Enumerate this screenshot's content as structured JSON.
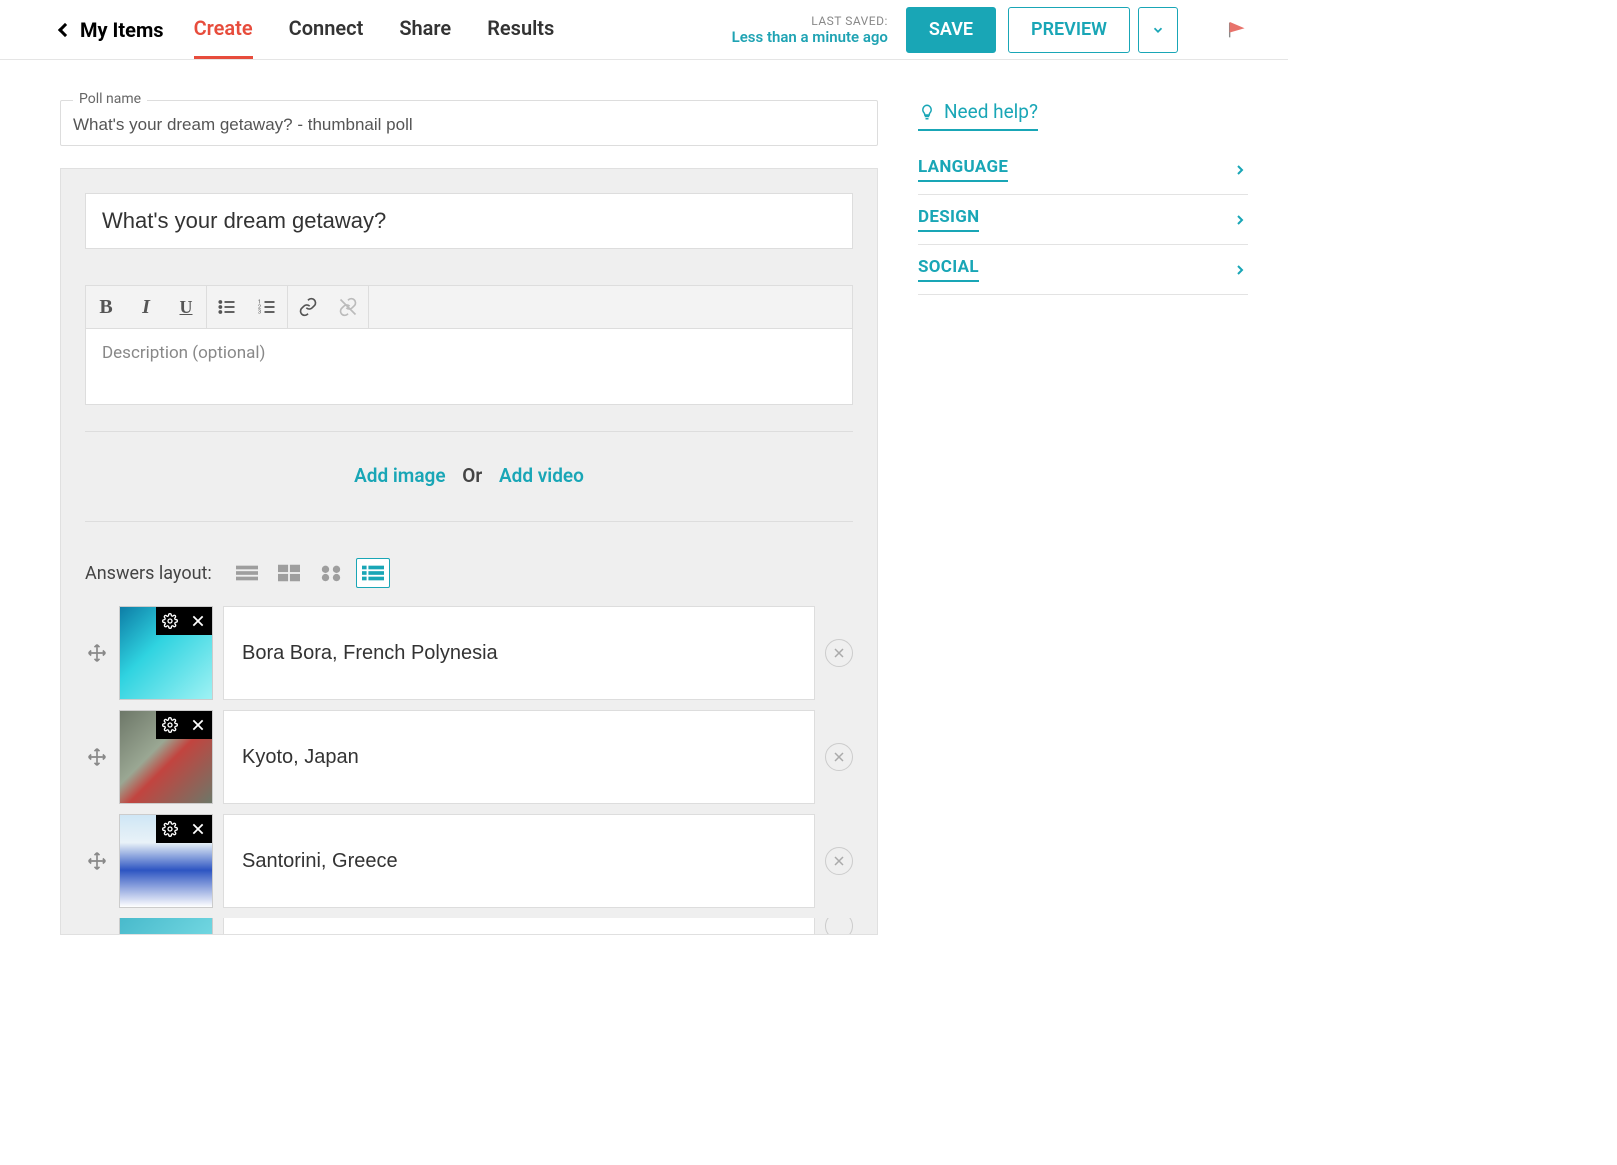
{
  "header": {
    "my_items": "My Items",
    "tabs": [
      "Create",
      "Connect",
      "Share",
      "Results"
    ],
    "active_tab_index": 0,
    "last_saved_label": "LAST SAVED:",
    "last_saved_time": "Less than a minute ago",
    "save": "SAVE",
    "preview": "PREVIEW"
  },
  "poll": {
    "name_legend": "Poll name",
    "name_value": "What's your dream getaway? - thumbnail poll",
    "title_value": "What's your dream getaway?",
    "description_placeholder": "Description (optional)",
    "add_image": "Add image",
    "or": "Or",
    "add_video": "Add video",
    "answers_layout_label": "Answers layout:",
    "answers": [
      {
        "text": "Bora Bora, French Polynesia"
      },
      {
        "text": "Kyoto, Japan"
      },
      {
        "text": "Santorini, Greece"
      },
      {
        "text": ""
      }
    ]
  },
  "side": {
    "need_help": "Need help?",
    "items": [
      "LANGUAGE",
      "DESIGN",
      "SOCIAL"
    ]
  }
}
